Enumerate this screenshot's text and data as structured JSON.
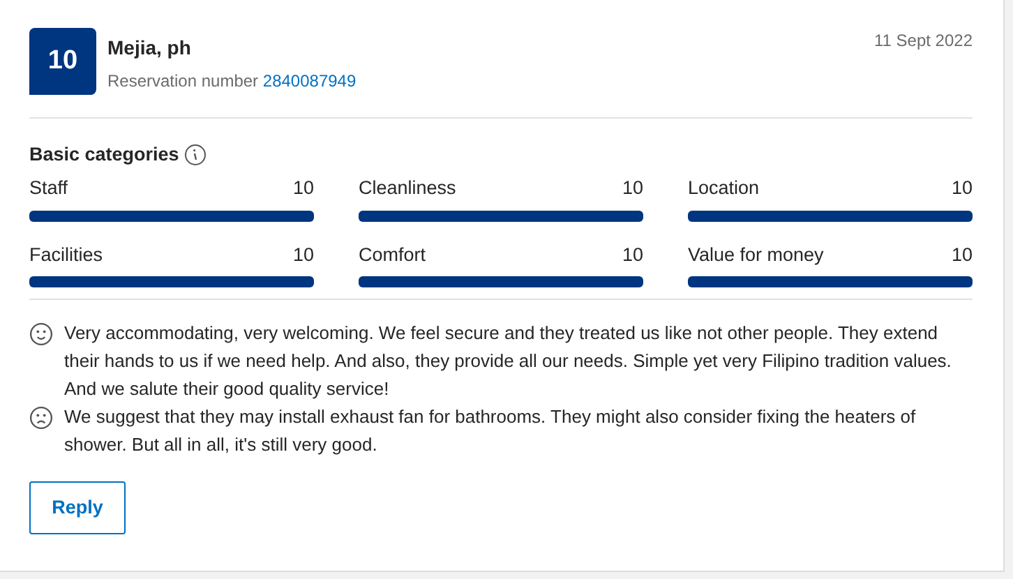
{
  "review": {
    "score": "10",
    "reviewer": "Mejia, ph",
    "reservation_label": "Reservation number",
    "reservation_number": "2840087949",
    "date": "11 Sept 2022"
  },
  "categories": {
    "title": "Basic categories",
    "items": [
      {
        "name": "Staff",
        "score": "10",
        "level": 1
      },
      {
        "name": "Cleanliness",
        "score": "10",
        "level": 1
      },
      {
        "name": "Location",
        "score": "10",
        "level": 1
      },
      {
        "name": "Facilities",
        "score": "10",
        "level": 1
      },
      {
        "name": "Comfort",
        "score": "10",
        "level": 1
      },
      {
        "name": "Value for money",
        "score": "10",
        "level": 1
      }
    ]
  },
  "comments": [
    {
      "kind": "positive",
      "text": "Very accommodating, very welcoming. We feel secure and they treated us like not other people. They extend their hands to us if we need help. And also, they provide all our needs. Simple yet very Filipino tradition values. And we salute their good quality service!"
    },
    {
      "kind": "negative",
      "text": "We suggest that they may install exhaust fan for bathrooms. They might also consider fixing the heaters of shower. But all in all, it's still very good."
    }
  ],
  "buttons": [
    {
      "label": "Reply"
    }
  ]
}
